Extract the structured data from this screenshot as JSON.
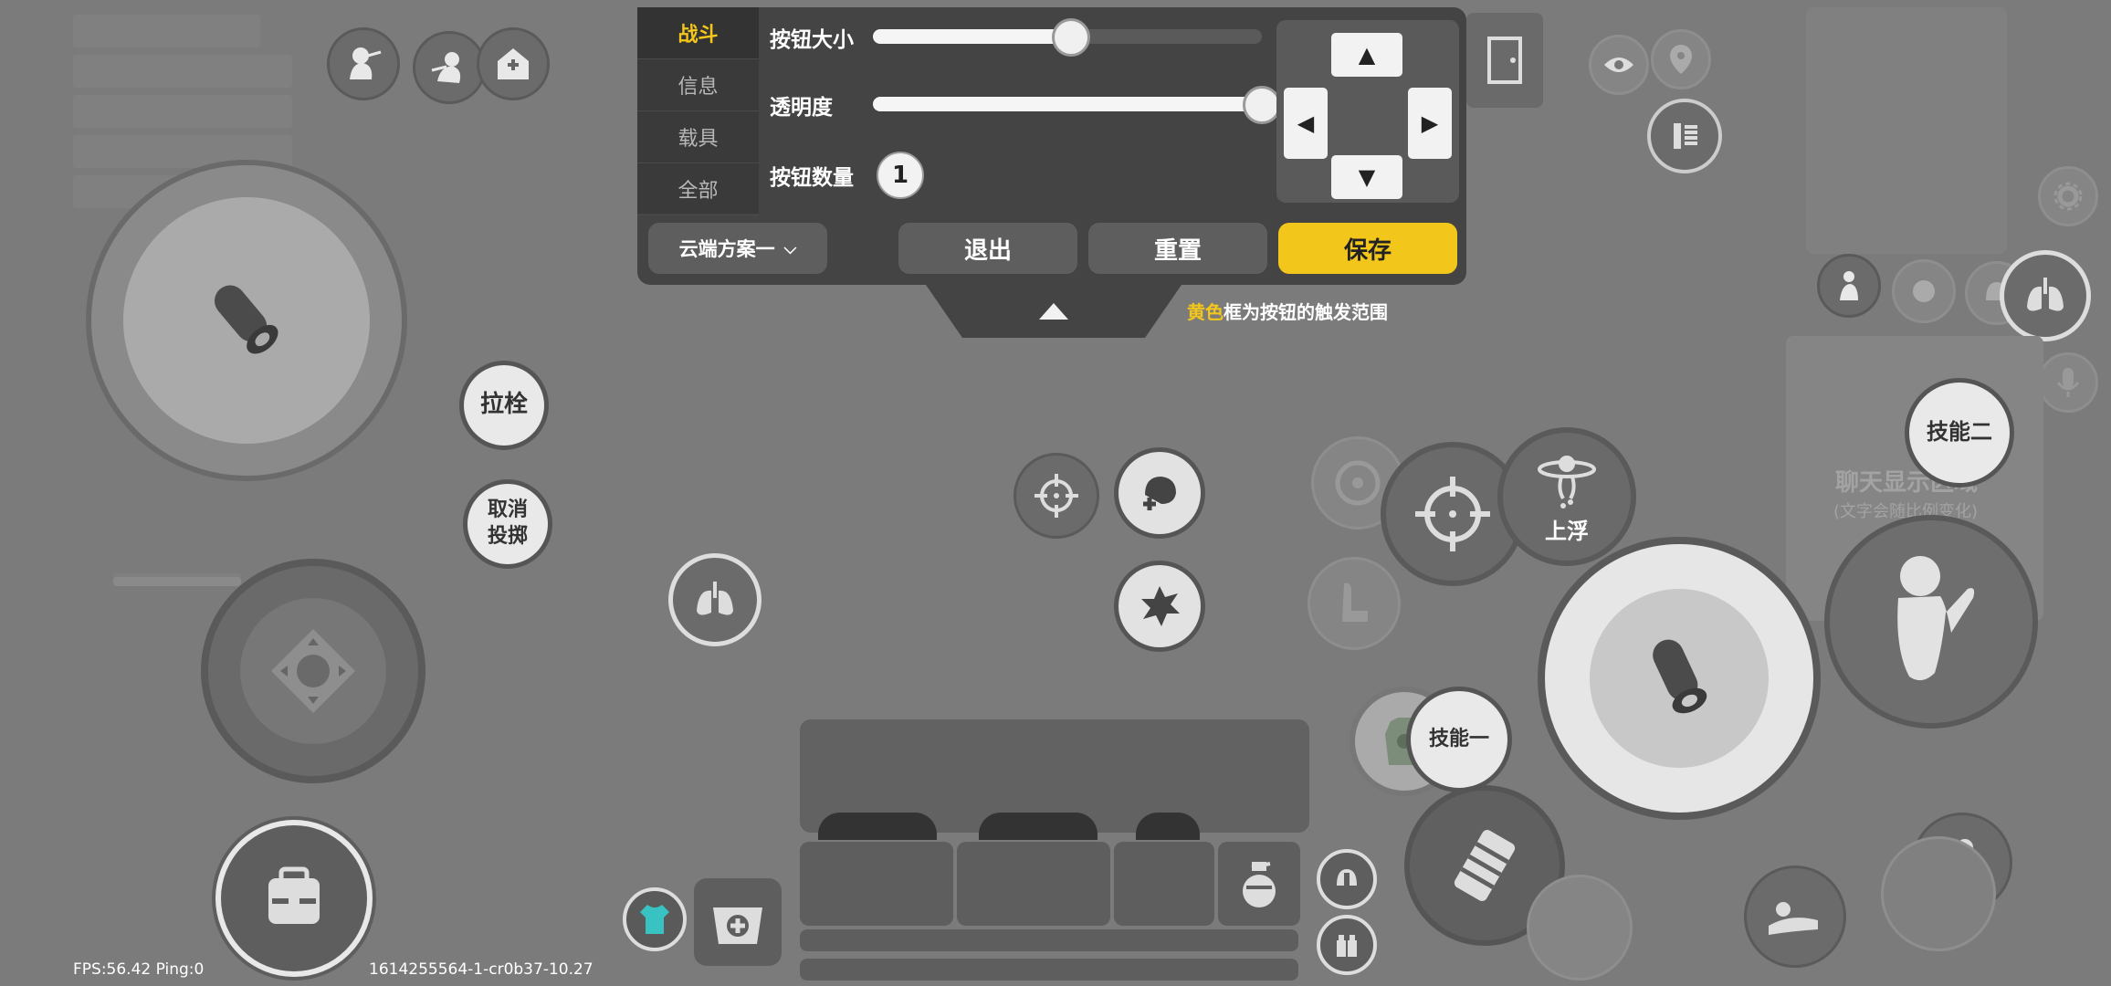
{
  "settings_panel": {
    "tabs": [
      "战斗",
      "信息",
      "载具",
      "全部"
    ],
    "button_size_label": "按钮大小",
    "button_size_value": 0.51,
    "opacity_label": "透明度",
    "opacity_value": 1.0,
    "button_count_label": "按钮数量",
    "button_count_value": "1",
    "scheme_selector": "云端方案一",
    "exit_label": "退出",
    "reset_label": "重置",
    "save_label": "保存",
    "hint_highlight": "黄色",
    "hint_rest": "框为按钮的触发范围"
  },
  "hud": {
    "pull_bolt": "拉栓",
    "cancel_throw_line1": "取消",
    "cancel_throw_line2": "投掷",
    "float_up": "上浮",
    "skill_one": "技能一",
    "skill_two": "技能二",
    "chat_line1": "聊天显示区域",
    "chat_line2": "(文字会随比例变化)"
  },
  "status": {
    "fps_ping": "FPS:56.42 Ping:0",
    "build": "1614255564-1-cr0b37-10.27"
  },
  "colors": {
    "accent": "#f3c61b",
    "panel": "#444444",
    "background": "#7b7b7b"
  }
}
